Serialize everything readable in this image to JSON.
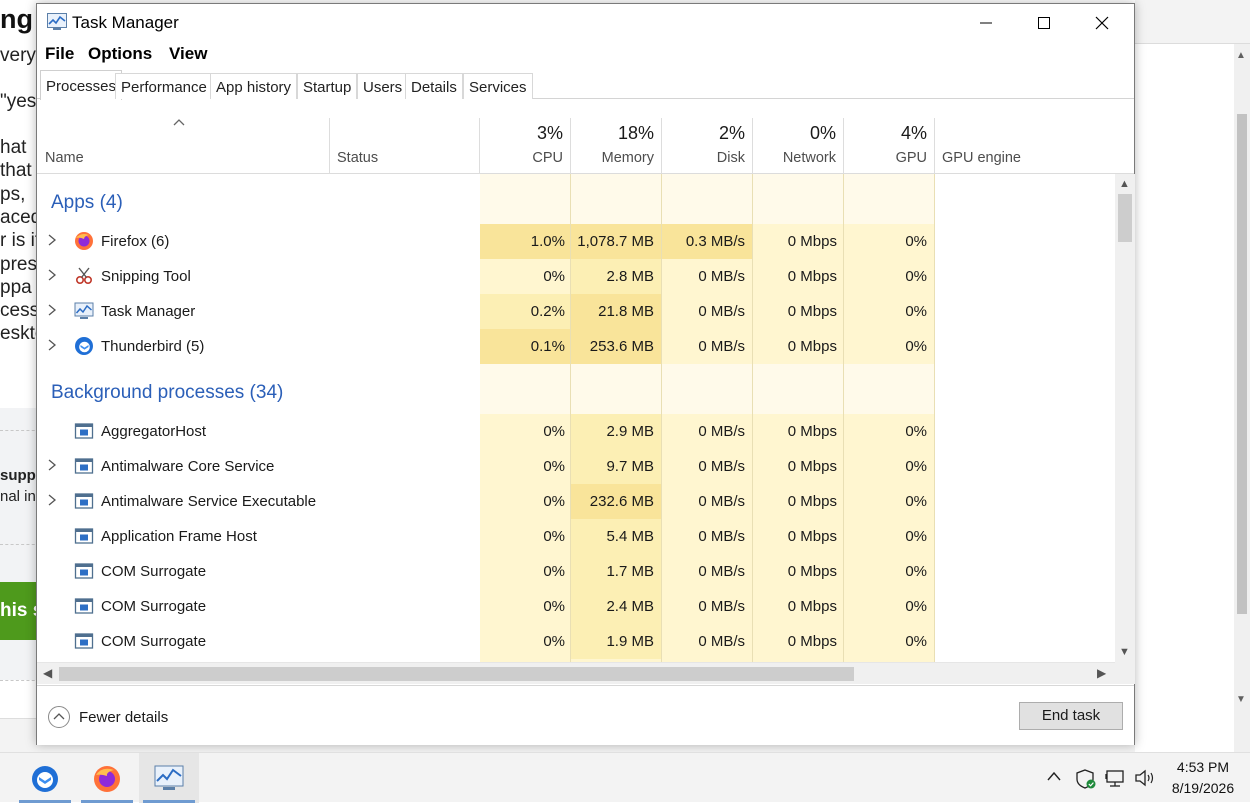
{
  "background": {
    "fragments": [
      "ng",
      "very",
      "\"yes",
      "hat",
      "that",
      "ps,",
      "aced",
      "r is it",
      "pres",
      "ppa",
      "cess",
      "eskto",
      "suppo",
      "nal inf",
      "his se"
    ]
  },
  "window": {
    "title": "Task Manager"
  },
  "menu": [
    "File",
    "Options",
    "View"
  ],
  "tabs": [
    "Processes",
    "Performance",
    "App history",
    "Startup",
    "Users",
    "Details",
    "Services"
  ],
  "active_tab": "Processes",
  "header": {
    "name": "Name",
    "status": "Status",
    "cpu": {
      "pct": "3%",
      "label": "CPU"
    },
    "memory": {
      "pct": "18%",
      "label": "Memory"
    },
    "disk": {
      "pct": "2%",
      "label": "Disk"
    },
    "network": {
      "pct": "0%",
      "label": "Network"
    },
    "gpu": {
      "pct": "4%",
      "label": "GPU"
    },
    "gpu_engine": "GPU engine"
  },
  "groups": {
    "apps": "Apps (4)",
    "background": "Background processes (34)"
  },
  "apps": [
    {
      "name": "Firefox (6)",
      "icon": "firefox-icon",
      "expandable": true,
      "cpu": "1.0%",
      "mem": "1,078.7 MB",
      "disk": "0.3 MB/s",
      "net": "0 Mbps",
      "gpu": "0%"
    },
    {
      "name": "Snipping Tool",
      "icon": "snipping-tool-icon",
      "expandable": true,
      "cpu": "0%",
      "mem": "2.8 MB",
      "disk": "0 MB/s",
      "net": "0 Mbps",
      "gpu": "0%"
    },
    {
      "name": "Task Manager",
      "icon": "task-manager-icon",
      "expandable": true,
      "cpu": "0.2%",
      "mem": "21.8 MB",
      "disk": "0 MB/s",
      "net": "0 Mbps",
      "gpu": "0%"
    },
    {
      "name": "Thunderbird (5)",
      "icon": "thunderbird-icon",
      "expandable": true,
      "cpu": "0.1%",
      "mem": "253.6 MB",
      "disk": "0 MB/s",
      "net": "0 Mbps",
      "gpu": "0%"
    }
  ],
  "background_processes": [
    {
      "name": "AggregatorHost",
      "icon": "service-icon",
      "expandable": false,
      "cpu": "0%",
      "mem": "2.9 MB",
      "disk": "0 MB/s",
      "net": "0 Mbps",
      "gpu": "0%"
    },
    {
      "name": "Antimalware Core Service",
      "icon": "service-icon",
      "expandable": true,
      "cpu": "0%",
      "mem": "9.7 MB",
      "disk": "0 MB/s",
      "net": "0 Mbps",
      "gpu": "0%"
    },
    {
      "name": "Antimalware Service Executable",
      "icon": "service-icon",
      "expandable": true,
      "cpu": "0%",
      "mem": "232.6 MB",
      "disk": "0 MB/s",
      "net": "0 Mbps",
      "gpu": "0%"
    },
    {
      "name": "Application Frame Host",
      "icon": "service-icon",
      "expandable": false,
      "cpu": "0%",
      "mem": "5.4 MB",
      "disk": "0 MB/s",
      "net": "0 Mbps",
      "gpu": "0%"
    },
    {
      "name": "COM Surrogate",
      "icon": "service-icon",
      "expandable": false,
      "cpu": "0%",
      "mem": "1.7 MB",
      "disk": "0 MB/s",
      "net": "0 Mbps",
      "gpu": "0%"
    },
    {
      "name": "COM Surrogate",
      "icon": "service-icon",
      "expandable": false,
      "cpu": "0%",
      "mem": "2.4 MB",
      "disk": "0 MB/s",
      "net": "0 Mbps",
      "gpu": "0%"
    },
    {
      "name": "COM Surrogate",
      "icon": "service-icon",
      "expandable": false,
      "cpu": "0%",
      "mem": "1.9 MB",
      "disk": "0 MB/s",
      "net": "0 Mbps",
      "gpu": "0%"
    }
  ],
  "footer": {
    "fewer_details": "Fewer details",
    "end_task": "End task"
  },
  "taskbar": {
    "apps": [
      "thunderbird-icon",
      "firefox-icon",
      "task-manager-icon"
    ],
    "active_app": "task-manager-icon",
    "time": "4:53 PM",
    "date": "8/19/2026"
  },
  "colors": {
    "heat_light": "#fff6d0",
    "heat_medium": "#fcefb4",
    "heat_strong": "#f9e49a",
    "group_blue": "#2b5fb8"
  }
}
